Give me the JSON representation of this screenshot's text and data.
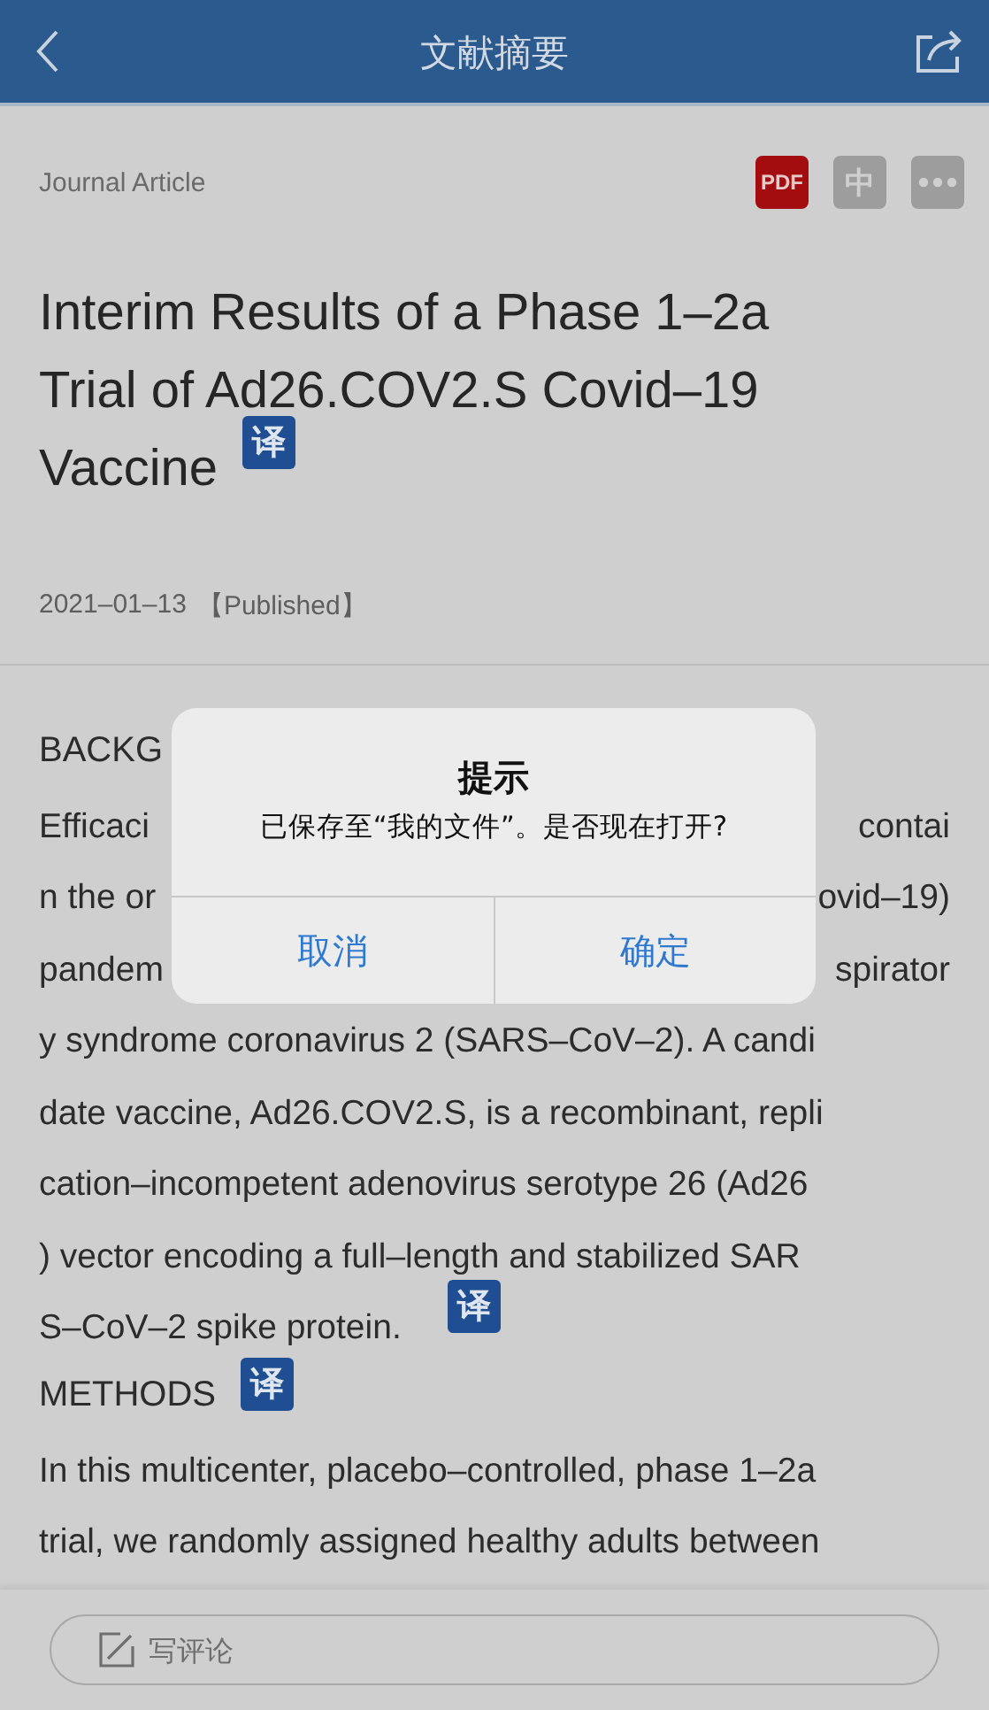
{
  "nav": {
    "title": "文献摘要"
  },
  "article_type": "Journal Article",
  "actions": [
    {
      "kind": "pdf",
      "label": "PDF"
    },
    {
      "kind": "chinese",
      "label": "中"
    },
    {
      "kind": "more"
    }
  ],
  "title_lines": [
    "Interim Results of a Phase 1–2a",
    "Trial of Ad26.COV2.S Covid–19",
    "Vaccine"
  ],
  "title_translate": "译",
  "date": "2021–01–13",
  "status": "【Published】",
  "sections": [
    {
      "heading": "BACKG",
      "translate": "译",
      "lines": [
        {
          "kind": "split",
          "left": "Efficaci",
          "right": "contai"
        },
        {
          "kind": "split",
          "left": "n the or",
          "right": "ovid–19)"
        },
        {
          "kind": "split",
          "left": "pandem",
          "right": "spirator"
        },
        {
          "kind": "full",
          "text": "y syndrome coronavirus 2 (SARS–CoV–2). A candi"
        },
        {
          "kind": "full",
          "text": "date vaccine, Ad26.COV2.S, is a recombinant, repli"
        },
        {
          "kind": "full",
          "text": "cation–incompetent adenovirus serotype 26 (Ad26"
        },
        {
          "kind": "full",
          "text": ") vector encoding a full–length and stabilized SAR"
        },
        {
          "kind": "full",
          "text": "S–CoV–2 spike protein."
        }
      ]
    },
    {
      "heading": "METHODS",
      "heading_translate": "译",
      "lines": [
        {
          "kind": "full",
          "text": "In this multicenter, placebo–controlled, phase 1–2a"
        },
        {
          "kind": "full",
          "text": "trial, we randomly assigned healthy adults between"
        }
      ]
    }
  ],
  "comment": {
    "placeholder": "写评论"
  },
  "dialog": {
    "title": "提示",
    "message": "已保存至“我的文件”。是否现在打开?",
    "buttons": [
      "取消",
      "确定"
    ]
  }
}
